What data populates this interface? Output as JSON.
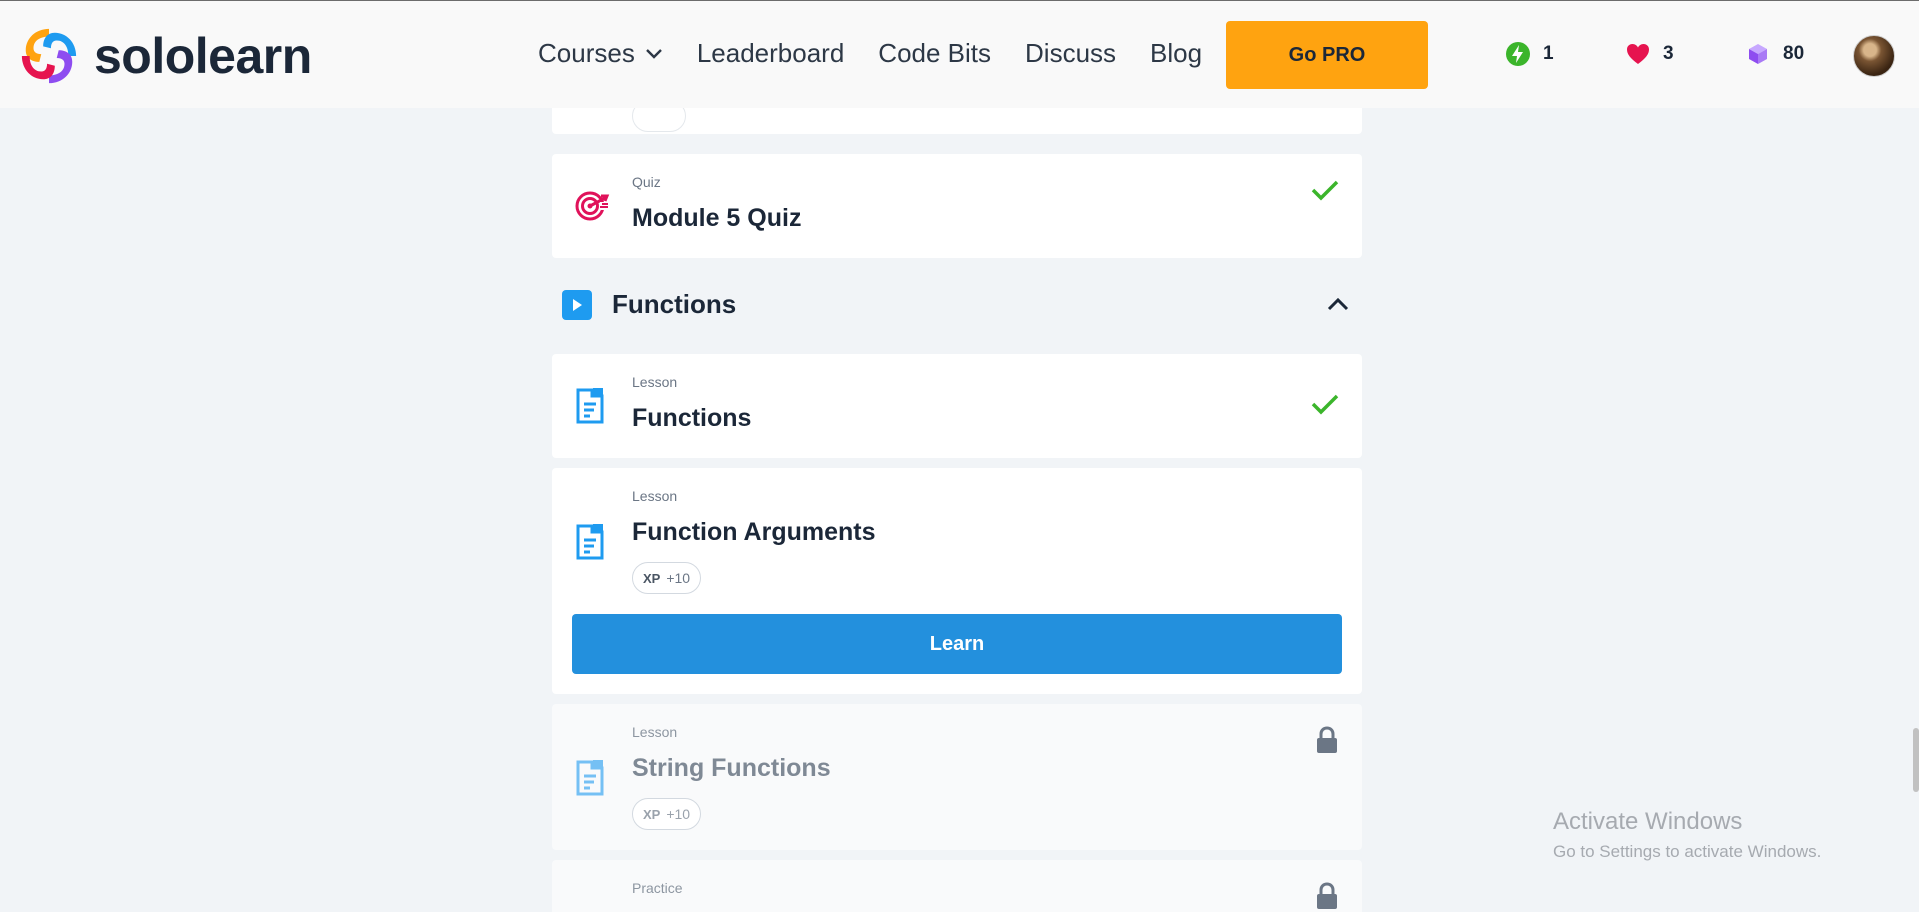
{
  "header": {
    "brand": "sololearn",
    "nav": [
      {
        "label": "Courses",
        "has_dropdown": true
      },
      {
        "label": "Leaderboard"
      },
      {
        "label": "Code Bits"
      },
      {
        "label": "Discuss"
      },
      {
        "label": "Blog"
      }
    ],
    "pro_button": "Go PRO",
    "stats": {
      "streak": "1",
      "hearts": "3",
      "bits": "80"
    }
  },
  "content": {
    "quiz": {
      "kind": "Quiz",
      "title": "Module 5 Quiz",
      "completed": true
    },
    "section": {
      "title": "Functions",
      "expanded": true
    },
    "lessons": [
      {
        "kind": "Lesson",
        "title": "Functions",
        "completed": true
      },
      {
        "kind": "Lesson",
        "title": "Function Arguments",
        "xp_label": "XP",
        "xp_value": "+10",
        "action": "Learn"
      },
      {
        "kind": "Lesson",
        "title": "String Functions",
        "xp_label": "XP",
        "xp_value": "+10",
        "locked": true
      },
      {
        "kind": "Practice",
        "locked": true
      }
    ]
  },
  "watermark": {
    "line1": "Activate Windows",
    "line2": "Go to Settings to activate Windows."
  },
  "colors": {
    "brand_orange": "#ffa310",
    "primary_blue": "#2390dd",
    "success_green": "#3bb52b",
    "heart_pink": "#e6144f",
    "quiz_red": "#e0125a",
    "bits_purple": "#9a6cf0"
  },
  "icons": {
    "logo": "sololearn-logo-icon",
    "streak": "lightning-icon",
    "hearts": "heart-icon",
    "bits": "cube-icon",
    "quiz": "target-icon",
    "lesson": "document-icon",
    "section": "play-icon",
    "done": "checkmark-icon",
    "locked": "lock-icon"
  }
}
